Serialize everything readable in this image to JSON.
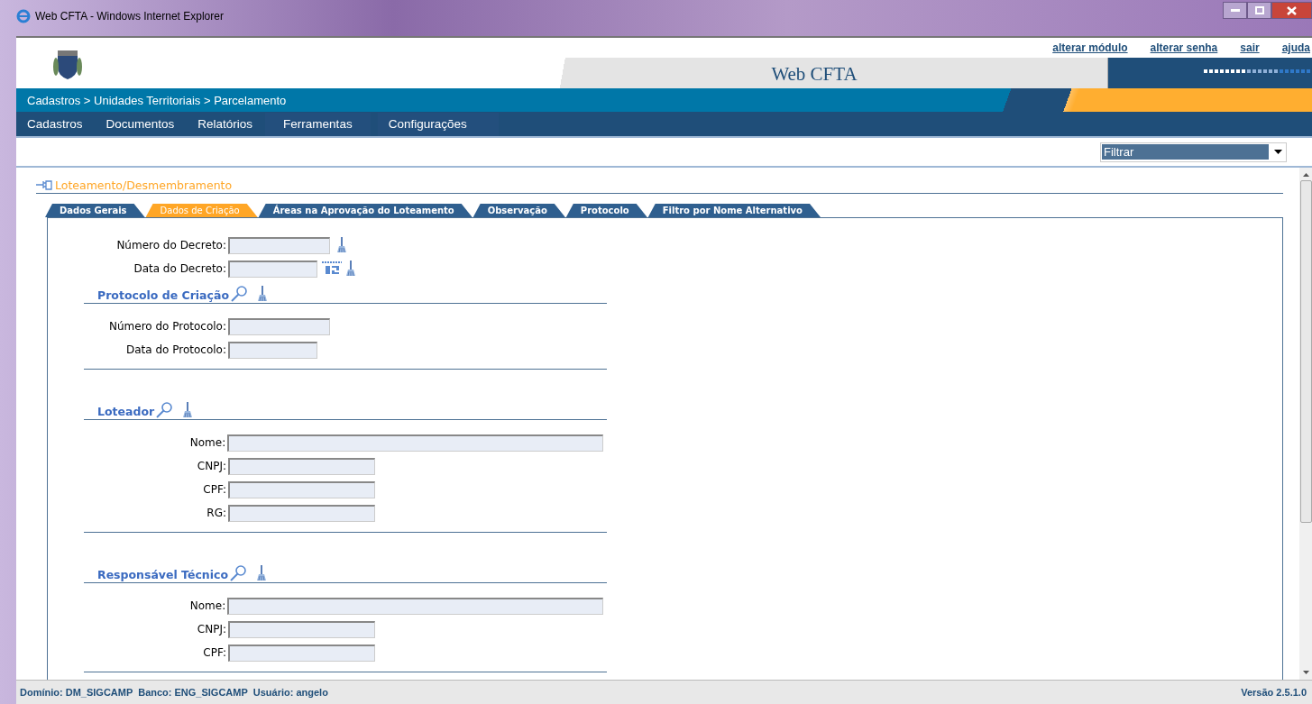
{
  "window": {
    "title": "Web CFTA - Windows Internet Explorer"
  },
  "header": {
    "links": [
      "alterar módulo",
      "alterar senha",
      "sair",
      "ajuda"
    ],
    "app_title": "Web CFTA"
  },
  "breadcrumb": "Cadastros > Unidades Territoriais > Parcelamento",
  "menu": [
    "Cadastros",
    "Documentos",
    "Relatórios",
    "Ferramentas",
    "Configurações"
  ],
  "filter": {
    "value": "Filtrar"
  },
  "page_title": "Loteamento/Desmembramento",
  "tabs": [
    {
      "label": "Dados Gerais",
      "selected": false
    },
    {
      "label": "Dados de Criação",
      "selected": true
    },
    {
      "label": "Áreas na Aprovação do Loteamento",
      "selected": false
    },
    {
      "label": "Observação",
      "selected": false
    },
    {
      "label": "Protocolo",
      "selected": false
    },
    {
      "label": "Filtro por Nome Alternativo",
      "selected": false
    }
  ],
  "decree_fields": [
    {
      "label": "Número do Decreto:",
      "kind": "number",
      "calendar": false,
      "clear": true
    },
    {
      "label": "Data do Decreto:",
      "kind": "date",
      "calendar": true,
      "clear": true
    }
  ],
  "sections": [
    {
      "title": "Protocolo de Criação",
      "fields": [
        {
          "label": "Número do Protocolo:",
          "kind": "number"
        },
        {
          "label": "Data do Protocolo:",
          "kind": "date"
        }
      ]
    },
    {
      "title": "Loteador",
      "fields": [
        {
          "label": "Nome:",
          "kind": "name"
        },
        {
          "label": "CNPJ:",
          "kind": "document"
        },
        {
          "label": "CPF:",
          "kind": "document"
        },
        {
          "label": "RG:",
          "kind": "document"
        }
      ]
    },
    {
      "title": "Responsável Técnico",
      "fields": [
        {
          "label": "Nome:",
          "kind": "name"
        },
        {
          "label": "CNPJ:",
          "kind": "document"
        },
        {
          "label": "CPF:",
          "kind": "document"
        }
      ]
    }
  ],
  "status_bar": {
    "left": "Domínio: DM_SIGCAMP  Banco: ENG_SIGCAMP  Usuário: angelo",
    "right": "Versão 2.5.1.0"
  }
}
